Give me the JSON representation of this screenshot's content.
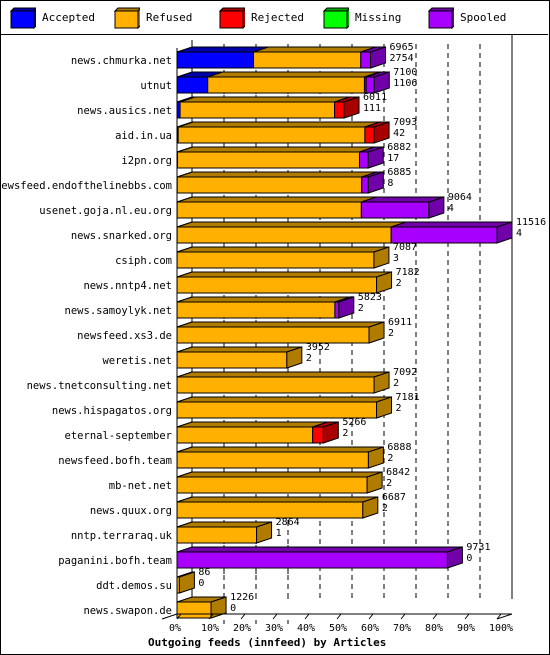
{
  "chart_data": {
    "type": "bar",
    "orientation": "horizontal",
    "stacked": true,
    "style": "3d",
    "title": "Outgoing feeds (innfeed) by Articles",
    "xlabel": "Outgoing feeds (innfeed) by Articles",
    "ylabel": "",
    "xlim": [
      0,
      100
    ],
    "x_ticks": [
      "0%",
      "10%",
      "20%",
      "30%",
      "40%",
      "50%",
      "60%",
      "70%",
      "80%",
      "90%",
      "100%"
    ],
    "grid": true,
    "legend_position": "top",
    "legend": [
      {
        "name": "Accepted",
        "color": "#0000ff",
        "side": "#0000a8"
      },
      {
        "name": "Refused",
        "color": "#ffb000",
        "side": "#b07c00"
      },
      {
        "name": "Rejected",
        "color": "#ff0000",
        "side": "#a80000"
      },
      {
        "name": "Missing",
        "color": "#00ff00",
        "side": "#00a800"
      },
      {
        "name": "Spooled",
        "color": "#a800ff",
        "side": "#7000a8"
      }
    ],
    "max_total": 11516,
    "categories": [
      "news.chmurka.net",
      "utnut",
      "news.ausics.net",
      "aid.in.ua",
      "i2pn.org",
      "newsfeed.endofthelinebbs.com",
      "usenet.goja.nl.eu.org",
      "news.snarked.org",
      "csiph.com",
      "news.nntp4.net",
      "news.samoylyk.net",
      "newsfeed.xs3.de",
      "weretis.net",
      "news.tnetconsulting.net",
      "news.hispagatos.org",
      "eternal-september",
      "newsfeed.bofh.team",
      "mb-net.net",
      "news.quux.org",
      "nntp.terraraq.uk",
      "paganini.bofh.team",
      "ddt.demos.su",
      "news.swapon.de"
    ],
    "labels_total": [
      6965,
      7100,
      6011,
      7093,
      6882,
      6885,
      9064,
      11516,
      7087,
      7182,
      5823,
      6911,
      3952,
      7092,
      7181,
      5266,
      6888,
      6842,
      6687,
      2864,
      9731,
      86,
      1226
    ],
    "labels_second": [
      2754,
      1106,
      111,
      42,
      17,
      8,
      4,
      4,
      3,
      2,
      2,
      2,
      2,
      2,
      2,
      2,
      2,
      2,
      2,
      1,
      0,
      0,
      0
    ],
    "series": [
      {
        "name": "Accepted",
        "values": [
          2754,
          1106,
          111,
          42,
          17,
          8,
          4,
          4,
          3,
          2,
          2,
          2,
          2,
          2,
          2,
          2,
          2,
          2,
          2,
          1,
          0,
          0,
          0
        ]
      },
      {
        "name": "Refused",
        "values": [
          3860,
          5640,
          5560,
          6720,
          6550,
          6640,
          6630,
          7700,
          7084,
          7180,
          5680,
          6909,
          3950,
          7090,
          7179,
          4880,
          6886,
          6840,
          6685,
          2863,
          0,
          86,
          1226
        ]
      },
      {
        "name": "Rejected",
        "values": [
          0,
          60,
          340,
          331,
          0,
          0,
          0,
          0,
          0,
          0,
          0,
          0,
          0,
          0,
          0,
          384,
          0,
          0,
          0,
          0,
          0,
          0,
          0
        ]
      },
      {
        "name": "Missing",
        "values": [
          0,
          0,
          0,
          0,
          0,
          0,
          0,
          0,
          0,
          0,
          0,
          0,
          0,
          0,
          0,
          0,
          0,
          0,
          0,
          0,
          0,
          0,
          0
        ]
      },
      {
        "name": "Spooled",
        "values": [
          351,
          294,
          0,
          0,
          315,
          237,
          2430,
          3812,
          0,
          0,
          141,
          0,
          0,
          0,
          0,
          0,
          0,
          0,
          0,
          0,
          9731,
          0,
          0
        ]
      }
    ]
  }
}
